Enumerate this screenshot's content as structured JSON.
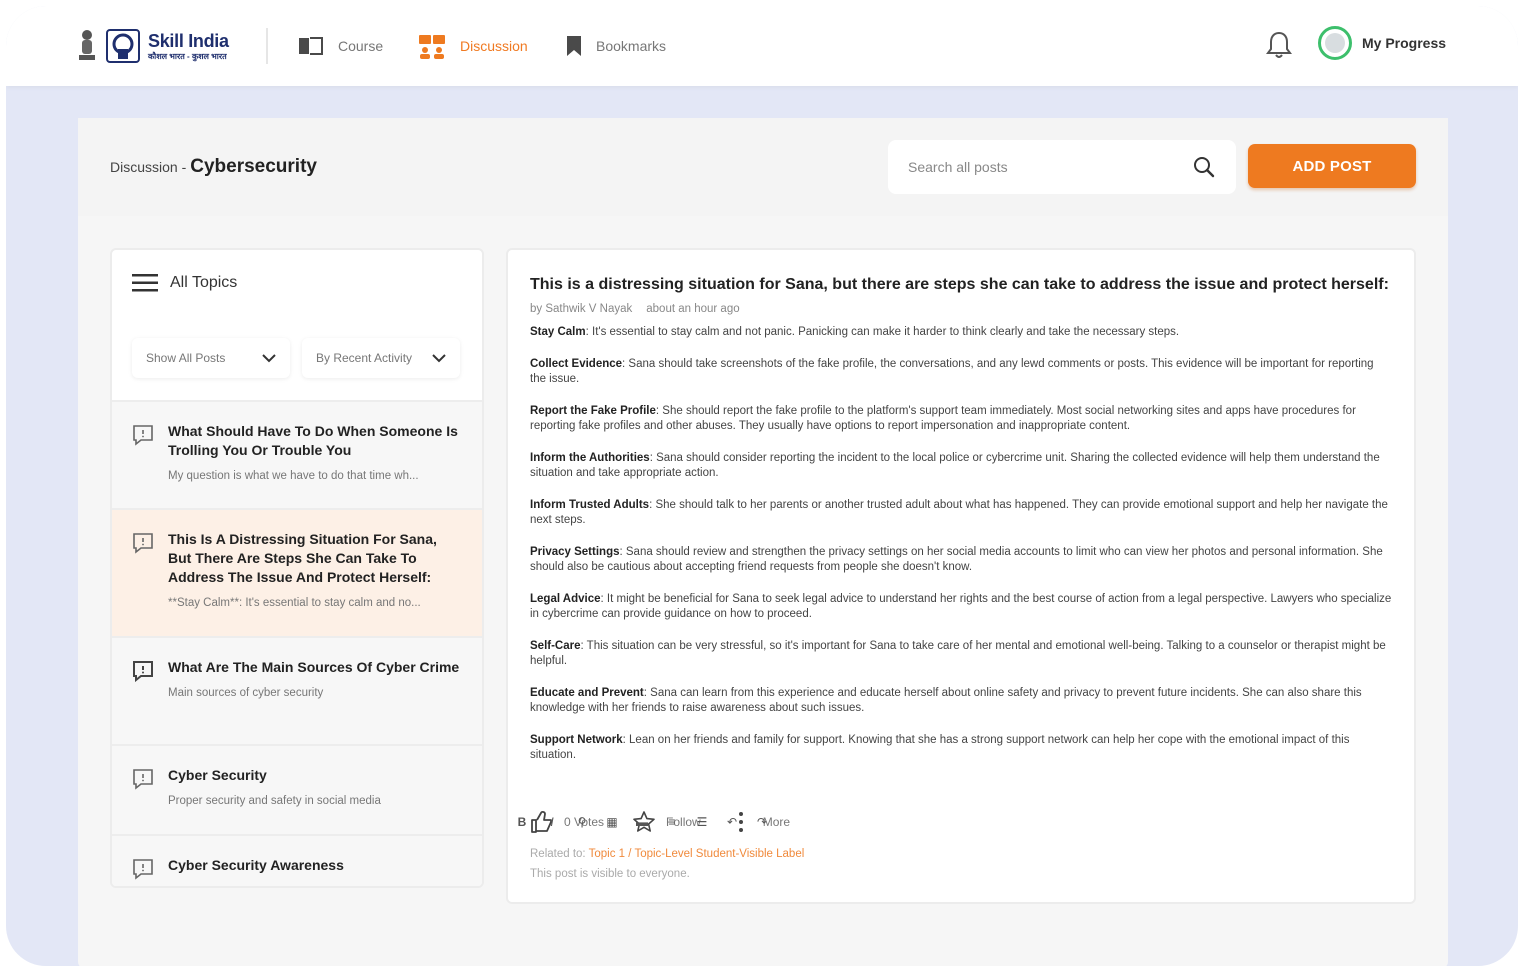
{
  "brand": {
    "name": "Skill India",
    "tagline": "कौशल भारत - कुशल भारत"
  },
  "nav": {
    "items": [
      {
        "label": "Course",
        "icon": "book-icon"
      },
      {
        "label": "Discussion",
        "icon": "discussion-icon",
        "active": true
      },
      {
        "label": "Bookmarks",
        "icon": "bookmark-icon"
      }
    ],
    "progress_label": "My Progress"
  },
  "header": {
    "breadcrumb_parent": "Discussion -",
    "breadcrumb_current": "Cybersecurity",
    "search_placeholder": "Search all posts",
    "add_post_label": "ADD POST"
  },
  "sidebar": {
    "title": "All Topics",
    "filter_posts": "Show All Posts",
    "filter_sort": "By Recent Activity",
    "topics": [
      {
        "title": "What Should Have To Do When Someone Is Trolling You Or Trouble You",
        "snippet": "My question is what we have to do that time wh..."
      },
      {
        "title": "This Is A Distressing Situation For Sana, But There Are Steps She Can Take To Address The Issue And Protect Herself:",
        "snippet": "**Stay Calm**: It's essential to stay calm and no..."
      },
      {
        "title": "What Are The Main Sources Of Cyber Crime",
        "snippet": "Main sources of cyber security"
      },
      {
        "title": "Cyber Security",
        "snippet": "Proper security and safety in social media"
      },
      {
        "title": "Cyber Security Awareness",
        "snippet": ""
      }
    ]
  },
  "post": {
    "title": "This is a distressing situation for Sana, but there are steps she can take to address the issue and protect herself:",
    "author": "by Sathwik V Nayak",
    "time": "about an hour ago",
    "paragraphs": [
      {
        "head": "Stay Calm",
        "text": ": It's essential to stay calm and not panic. Panicking can make it harder to think clearly and take the necessary steps."
      },
      {
        "head": "Collect Evidence",
        "text": ": Sana should take screenshots of the fake profile, the conversations, and any lewd comments or posts. This evidence will be important for reporting the issue."
      },
      {
        "head": "Report the Fake Profile",
        "text": ": She should report the fake profile to the platform's support team immediately. Most social networking sites and apps have procedures for reporting fake profiles and other abuses. They usually have options to report impersonation and inappropriate content."
      },
      {
        "head": "Inform the Authorities",
        "text": ": Sana should consider reporting the incident to the local police or cybercrime unit. Sharing the collected evidence will help them understand the situation and take appropriate action."
      },
      {
        "head": "Inform Trusted Adults",
        "text": ": She should talk to her parents or another trusted adult about what has happened. They can provide emotional support and help her navigate the next steps."
      },
      {
        "head": "Privacy Settings",
        "text": ": Sana should review and strengthen the privacy settings on her social media accounts to limit who can view her photos and personal information. She should also be cautious about accepting friend requests from people she doesn't know."
      },
      {
        "head": "Legal Advice",
        "text": ": It might be beneficial for Sana to seek legal advice to understand her rights and the best course of action from a legal perspective. Lawyers who specialize in cybercrime can provide guidance on how to proceed."
      },
      {
        "head": "Self-Care",
        "text": ": This situation can be very stressful, so it's important for Sana to take care of her mental and emotional well-being. Talking to a counselor or therapist might be helpful."
      },
      {
        "head": "Educate and Prevent",
        "text": ": Sana can learn from this experience and educate herself about online safety and privacy to prevent future incidents. She can also share this knowledge with her friends to raise awareness about such issues."
      },
      {
        "head": "Support Network",
        "text": ": Lean on her friends and family for support. Knowing that she has a strong support network can help her cope with the emotional impact of this situation."
      }
    ],
    "votes_label": "0 Votes",
    "follow_label": "Follow",
    "more_label": "More",
    "related_prefix": "Related to:",
    "related_link": "Topic 1 / Topic-Level Student-Visible Label",
    "visibility": "This post is visible to everyone."
  },
  "colors": {
    "accent": "#ee7a20",
    "selected_bg": "#fdf0e6",
    "frame_bg": "#e3e7f6",
    "progress_ring": "#3dbf6c"
  }
}
